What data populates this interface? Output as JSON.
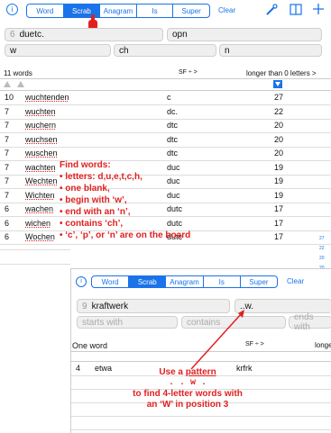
{
  "main": {
    "toolbar": {
      "info_icon_label": "i",
      "segments": [
        "Word",
        "Scrab",
        "Anagram",
        "Is",
        "Super"
      ],
      "active_index": 1,
      "clear_label": "Clear",
      "icons": [
        "tools-icon",
        "book-icon",
        "plus-icon"
      ]
    },
    "fields": {
      "letters_count": "6",
      "letters": "duetc.",
      "board": "opn",
      "starts_with": "w",
      "contains": "ch",
      "ends_with": "n"
    },
    "results_header": {
      "count": "11 words",
      "sort": "SF ÷ >",
      "length_filter": "longer than 0 letters >"
    },
    "rows": [
      {
        "len": "10",
        "word": "wuchtenden",
        "letters": "c",
        "score": "27"
      },
      {
        "len": "7",
        "word": "wuchten",
        "letters": "dc.",
        "score": "22"
      },
      {
        "len": "7",
        "word": "wuchern",
        "letters": "dtc",
        "score": "20"
      },
      {
        "len": "7",
        "word": "wuchsen",
        "letters": "dtc",
        "score": "20"
      },
      {
        "len": "7",
        "word": "wuschen",
        "letters": "dtc",
        "score": "20"
      },
      {
        "len": "7",
        "word": "wachten",
        "letters": "duc",
        "score": "19"
      },
      {
        "len": "7",
        "word": "Wechten",
        "letters": "duc",
        "score": "19"
      },
      {
        "len": "7",
        "word": "Wichten",
        "letters": "duc",
        "score": "19"
      },
      {
        "len": "6",
        "word": "wachen",
        "letters": "dutc",
        "score": "17"
      },
      {
        "len": "6",
        "word": "wichen",
        "letters": "dutc",
        "score": "17"
      },
      {
        "len": "6",
        "word": "Wochen",
        "letters": "dutc",
        "score": "17"
      }
    ],
    "side_numbers": [
      "27",
      "22",
      "20",
      "20"
    ]
  },
  "annotation1": {
    "lines": [
      "Find words:",
      "• letters: d,u,e,t,c,h,",
      "• one blank,",
      "• begin with ‘w’,",
      "• end with an ‘n’,",
      "• contains ‘ch’,",
      "• ‘c’, ‘p’, or ‘n’ are on the board"
    ]
  },
  "inset": {
    "toolbar": {
      "info_icon_label": "i",
      "segments": [
        "Word",
        "Scrab",
        "Anagram",
        "Is",
        "Super"
      ],
      "active_index": 1,
      "clear_label": "Clear"
    },
    "fields": {
      "letters_count": "9",
      "letters": "kraftwerk",
      "pattern": "..w.",
      "starts_with_placeholder": "starts with",
      "contains_placeholder": "contains",
      "ends_with_placeholder": "ends with"
    },
    "results_header": {
      "count": "One word",
      "sort": "SF ÷ >",
      "length_filter": "longe"
    },
    "row": {
      "len": "4",
      "word": "etwa",
      "letters": "krfrk"
    }
  },
  "annotation2": {
    "line1_prefix": "Use a ",
    "line1_link": "pattern",
    "line2": ". . w .",
    "line3": "to find 4-letter words with",
    "line4": "an ‘W’ in position 3"
  }
}
